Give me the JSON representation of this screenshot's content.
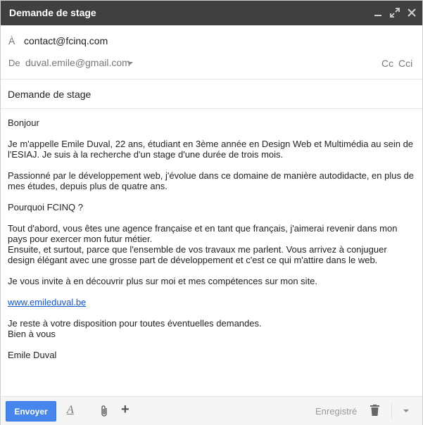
{
  "window": {
    "title": "Demande de stage",
    "controls": {
      "minimize_icon": "minimize-icon",
      "expand_icon": "expand-icon",
      "close_icon": "close-icon"
    }
  },
  "header": {
    "to_label": "À",
    "to_value": "contact@fcinq.com",
    "from_label": "De",
    "from_value": "duval.emile@gmail.com",
    "cc_label": "Cc",
    "cci_label": "Cci"
  },
  "subject": "Demande de stage",
  "body": {
    "greeting": "Bonjour",
    "p1": "Je m'appelle Emile Duval, 22 ans, étudiant en 3ème année en Design Web et Multimédia au sein de l'ESIAJ. Je suis à la recherche d'un stage d'une durée de trois mois.",
    "p2": "Passionné par le développement web, j'évolue dans ce domaine de manière autodidacte, en plus de mes études, depuis plus de quatre ans.",
    "p3": "Pourquoi FCINQ ?",
    "p4": "Tout d'abord, vous êtes une agence française et en tant que français, j'aimerai revenir dans mon pays pour exercer mon futur métier.\nEnsuite, et surtout, parce que l'ensemble de vos travaux me parlent. Vous arrivez à conjuguer design élégant avec une grosse part de développement et c'est ce qui m'attire dans le web.",
    "p5": "Je vous invite à en découvrir plus sur moi et mes compétences sur mon site.",
    "link": "www.emileduval.be",
    "p6": "Je reste à votre disposition pour toutes éventuelles demandes.\nBien à vous",
    "signature": "Emile Duval"
  },
  "footer": {
    "send_label": "Envoyer",
    "format_label": "A",
    "saved_label": "Enregistré"
  },
  "colors": {
    "titlebar": "#404040",
    "send_button": "#4787ed",
    "link": "#1155cc"
  }
}
